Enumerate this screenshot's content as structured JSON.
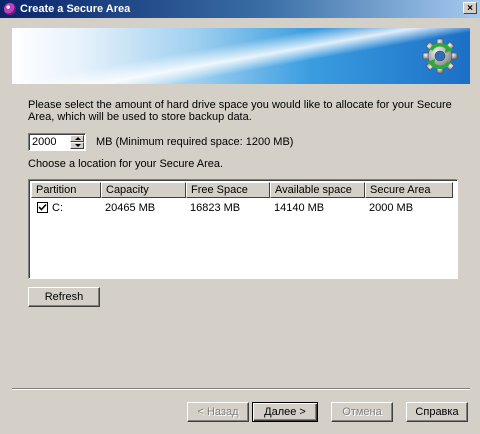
{
  "window": {
    "title": "Create a Secure Area",
    "close_glyph": "×"
  },
  "banner": {
    "logo_icon": "gear-refresh-icon"
  },
  "intro_text": "Please select the amount of hard drive space you would like to allocate for your Secure Area, which will be used to store backup data.",
  "size": {
    "value": "2000",
    "label": "MB (Minimum required space: 1200 MB)"
  },
  "choose_text": "Choose a location for your Secure Area.",
  "table": {
    "columns": [
      "Partition",
      "Capacity",
      "Free Space",
      "Available space",
      "Secure Area"
    ],
    "rows": [
      {
        "checked": true,
        "partition": "C:",
        "capacity": "20465 MB",
        "free_space": "16823 MB",
        "available_space": "14140 MB",
        "secure_area": "2000 MB"
      }
    ]
  },
  "buttons": {
    "refresh": "Refresh",
    "back": "< Назад",
    "next": "Далее >",
    "cancel": "Отмена",
    "help": "Справка"
  },
  "colors": {
    "window_bg": "#d4d0c8",
    "title_start": "#0a246a",
    "title_end": "#a6caf0"
  }
}
